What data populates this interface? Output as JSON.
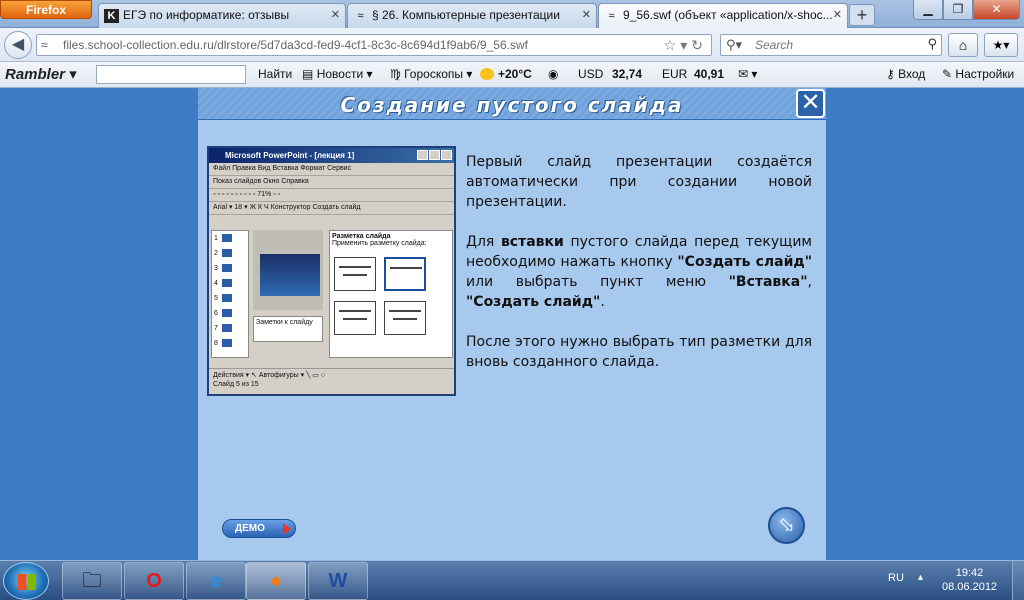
{
  "browser": {
    "app_button": "Firefox",
    "tabs": [
      {
        "label": "ЕГЭ по информатике: отзывы",
        "icon": "K"
      },
      {
        "label": "§ 26. Компьютерные презентации",
        "icon": "≈"
      },
      {
        "label": "9_56.swf (объект «application/x-shoc...",
        "icon": "≈"
      }
    ],
    "new_tab": "+",
    "url": "files.school-collection.edu.ru/dlrstore/5d7da3cd-fed9-4cf1-8c3c-8c694d1f9ab6/9_56.swf",
    "search_placeholder": "Search"
  },
  "rambler": {
    "logo": "Rambler",
    "find": "Найти",
    "news": "Новости",
    "horoscopes": "Гороскопы",
    "weather": "+20°C",
    "usd_label": "USD",
    "usd_value": "32,74",
    "eur_label": "EUR",
    "eur_value": "40,91",
    "login": "Вход",
    "settings": "Настройки"
  },
  "slide": {
    "title": "Создание пустого слайда",
    "close": "✕",
    "ppt": {
      "title": "Microsoft PowerPoint - [лекция 1]",
      "menu": "Файл  Правка  Вид  Вставка  Формат  Сервис",
      "toolbar1": "Показ слайдов  Окно  Справка",
      "toolbar2": "Конструктор  Создать слайд",
      "taskpane_title": "Разметка слайда",
      "taskpane_label": "Применить разметку слайда:",
      "notes": "Заметки к слайду",
      "status": "Слайд 5 из 15"
    },
    "paragraph1": "Первый слайд презентации создаётся автоматически при создании новой презентации.",
    "p2_part1": "Для ",
    "p2_bold1": "вставки",
    "p2_part2": " пустого слайда перед текущим необходимо нажать кнопку ",
    "p2_bold2": "\"Создать слайд\"",
    "p2_part3": " или выбрать пункт меню ",
    "p2_bold3": "\"Вставка\"",
    "p2_part4": ", ",
    "p2_bold4": "\"Создать слайд\"",
    "p2_part5": ".",
    "paragraph3": "После этого нужно выбрать тип разметки для вновь созданного слайда.",
    "demo_button": "ДЕМО"
  },
  "taskbar": {
    "lang": "RU",
    "time": "19:42",
    "date": "08.06.2012"
  }
}
